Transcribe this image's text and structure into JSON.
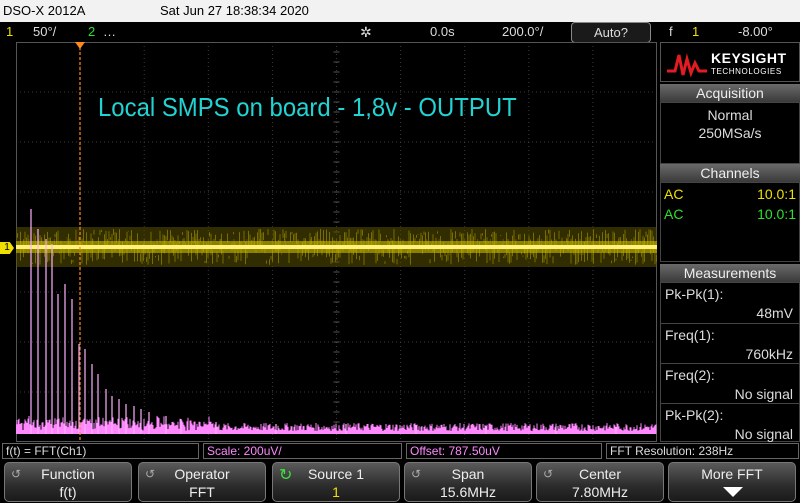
{
  "title_bar": {
    "model": "DSO-X 2012A",
    "datetime": "Sat Jun 27 18:38:34 2020"
  },
  "status": {
    "ch1_num": "1",
    "ch1_scale": "50°/",
    "ch2_num": "2",
    "ch2_scale": "…",
    "time_delay": "0.0s",
    "time_scale": "200.0°/",
    "trigger_mode": "Auto?",
    "trigger_symbol": "f",
    "trigger_ch": "1",
    "trigger_level": "-8.00°"
  },
  "annotation": "Local SMPS on board - 1,8v - OUTPUT",
  "ch1_marker": "1",
  "brand": {
    "name": "KEYSIGHT",
    "sub": "TECHNOLOGIES"
  },
  "acquisition": {
    "header": "Acquisition",
    "mode": "Normal",
    "rate": "250MSa/s"
  },
  "channels": {
    "header": "Channels",
    "items": [
      {
        "coupling": "AC",
        "probe": "10.0:1",
        "color": "#f0e000"
      },
      {
        "coupling": "AC",
        "probe": "10.0:1",
        "color": "#2ee02e"
      }
    ]
  },
  "measurements": {
    "header": "Measurements",
    "items": [
      {
        "label": "Pk-Pk(1):",
        "value": "48mV"
      },
      {
        "label": "Freq(1):",
        "value": "760kHz"
      },
      {
        "label": "Freq(2):",
        "value": "No signal"
      },
      {
        "label": "Pk-Pk(2):",
        "value": "No signal"
      }
    ]
  },
  "math_bar": {
    "function": "f(t) = FFT(Ch1)",
    "scale": "Scale: 200uV/",
    "offset": "Offset: 787.50uV",
    "resolution": "FFT Resolution: 238Hz"
  },
  "softkeys": [
    {
      "label": "Function",
      "value": "f(t)"
    },
    {
      "label": "Operator",
      "value": "FFT"
    },
    {
      "label": "Source 1",
      "value": "1"
    },
    {
      "label": "Span",
      "value": "15.6MHz"
    },
    {
      "label": "Center",
      "value": "7.80MHz"
    },
    {
      "label": "More FFT",
      "value": ""
    }
  ],
  "colors": {
    "ch1": "#f0e000",
    "ch2": "#2ee02e",
    "math": "#ff88ff",
    "trigger_line": "#ff8a1a",
    "annotation": "#22d3d3"
  }
}
